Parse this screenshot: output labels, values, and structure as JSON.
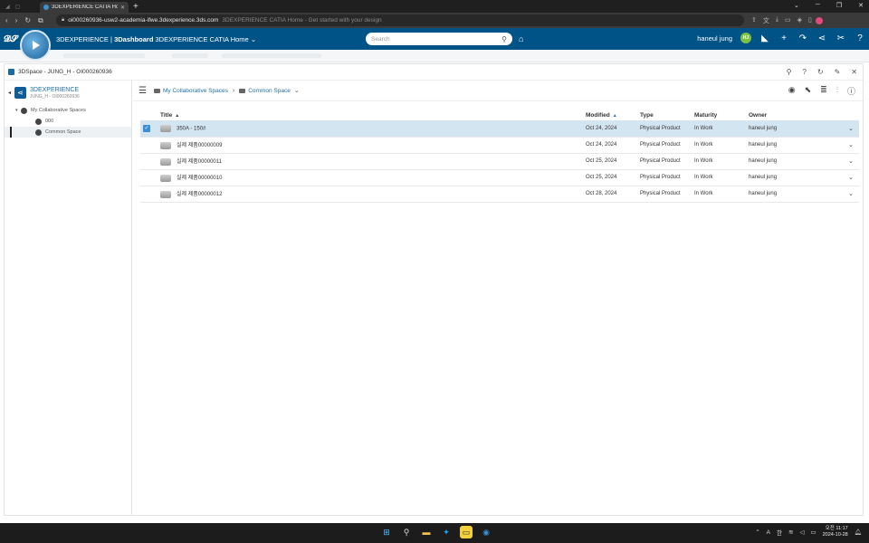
{
  "browser": {
    "tab_title": "3DEXPERIENCE CATIA Home - 3",
    "url": "oi000260936-usw2-academia-ifwe.3dexperience.3ds.com",
    "page_title": "3DEXPERIENCE CATIA Home - Get started with your design"
  },
  "topbar": {
    "brand_prefix": "3DEXPERIENCE | ",
    "brand_dashboard": "3Dashboard",
    "brand_home": " 3DEXPERIENCE CATIA Home",
    "search_placeholder": "Search",
    "user_name": "haneul jung",
    "user_initials": "HJ"
  },
  "widget": {
    "title": "3DSpace - JUNG_H - OI000260936"
  },
  "sidebar": {
    "title": "3DEXPERIENCE",
    "subtitle": "JUNG_H - OI000260936",
    "tree": [
      {
        "label": "My Collaborative Spaces"
      },
      {
        "label": "000"
      },
      {
        "label": "Common Space"
      }
    ]
  },
  "breadcrumb": {
    "items": [
      "My Collaborative Spaces",
      "Common Space"
    ]
  },
  "table": {
    "columns": [
      "Title",
      "Modified",
      "Type",
      "Maturity",
      "Owner"
    ],
    "rows": [
      {
        "title": "350A - 150#",
        "modified": "Oct 24, 2024",
        "type": "Physical Product",
        "maturity": "In Work",
        "owner": "haneul jung"
      },
      {
        "title": "실제 제품00000009",
        "modified": "Oct 24, 2024",
        "type": "Physical Product",
        "maturity": "In Work",
        "owner": "haneul jung"
      },
      {
        "title": "실제 제품00000011",
        "modified": "Oct 25, 2024",
        "type": "Physical Product",
        "maturity": "In Work",
        "owner": "haneul jung"
      },
      {
        "title": "실제 제품00000010",
        "modified": "Oct 25, 2024",
        "type": "Physical Product",
        "maturity": "In Work",
        "owner": "haneul jung"
      },
      {
        "title": "실제 제품00000012",
        "modified": "Oct 28, 2024",
        "type": "Physical Product",
        "maturity": "In Work",
        "owner": "haneul jung"
      }
    ]
  },
  "taskbar": {
    "lang": "A",
    "ime": "한",
    "time": "오전 11:17",
    "date": "2024-10-28"
  },
  "colors": {
    "topbar": "#005386",
    "selection": "#d4e5f2",
    "link": "#1e6fa8"
  }
}
